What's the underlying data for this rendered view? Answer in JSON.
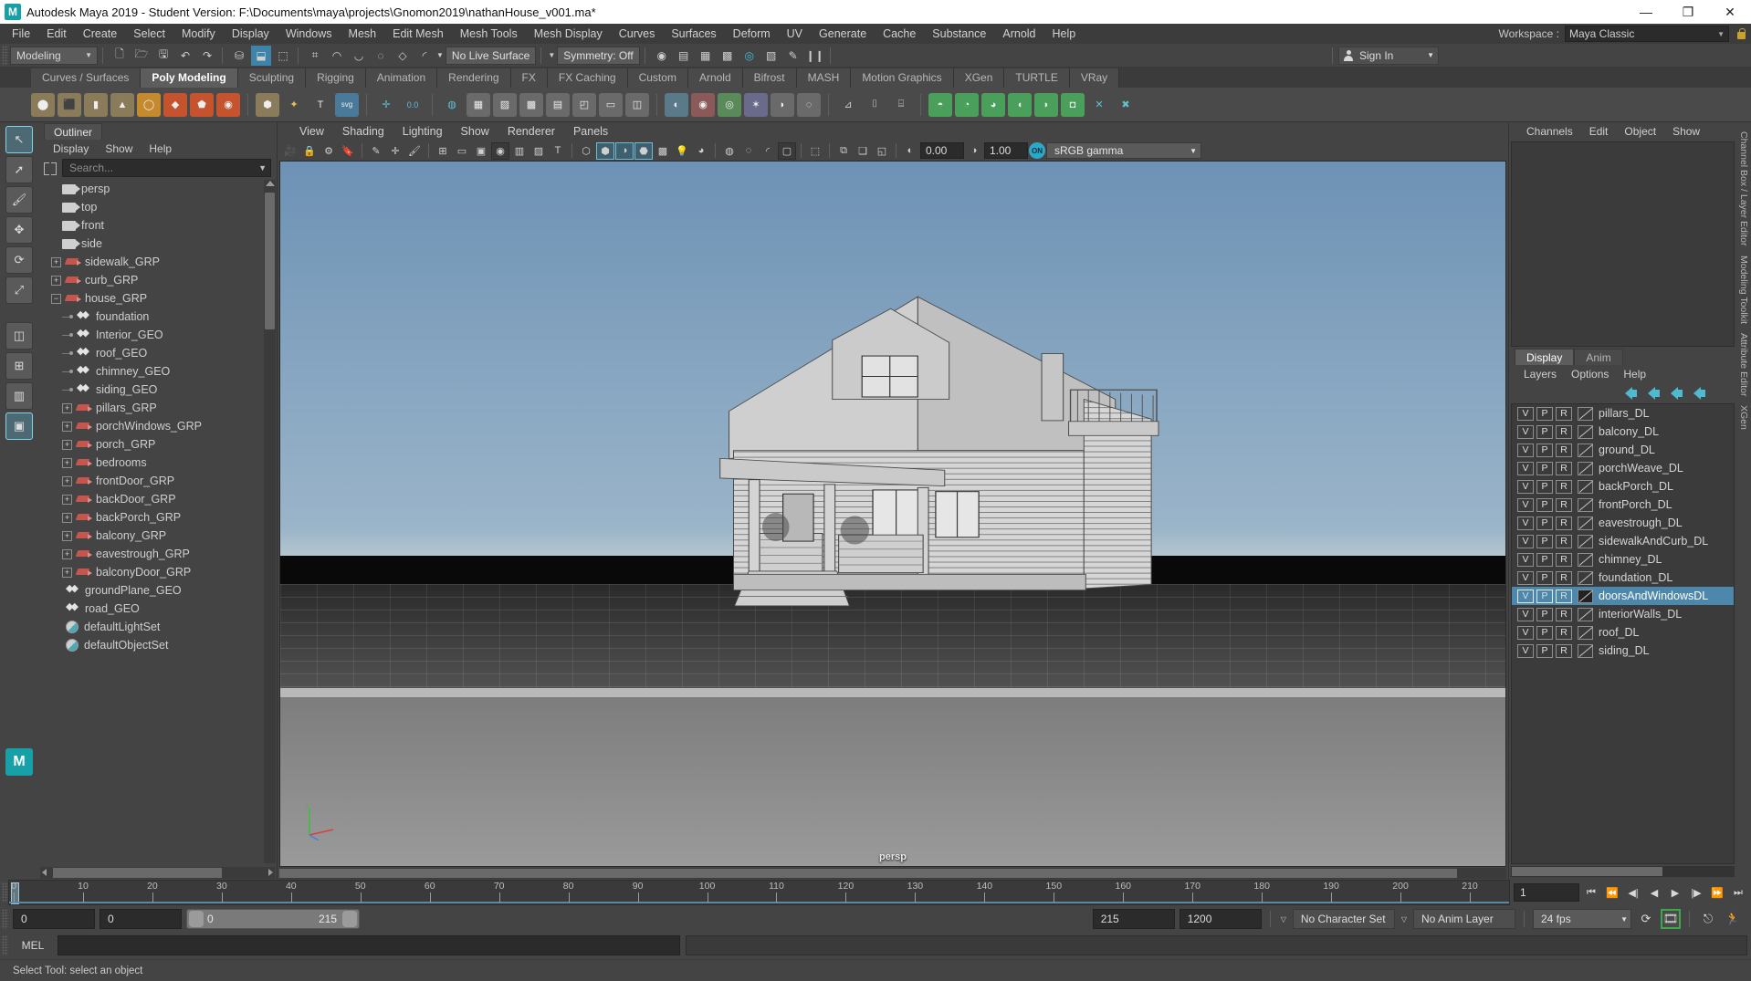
{
  "titlebar": {
    "title": "Autodesk Maya 2019 - Student Version: F:\\Documents\\maya\\projects\\Gnomon2019\\nathanHouse_v001.ma*",
    "minimize": "—",
    "maximize": "❐",
    "close": "✕",
    "logo": "M"
  },
  "menubar": {
    "items": [
      "File",
      "Edit",
      "Create",
      "Select",
      "Modify",
      "Display",
      "Windows",
      "Mesh",
      "Edit Mesh",
      "Mesh Tools",
      "Mesh Display",
      "Curves",
      "Surfaces",
      "Deform",
      "UV",
      "Generate",
      "Cache",
      "Substance",
      "Arnold",
      "Help"
    ],
    "workspace_label": "Workspace :",
    "workspace_value": "Maya Classic"
  },
  "statusline": {
    "menu_set": "Modeling",
    "live_surface": "No Live Surface",
    "symmetry": "Symmetry: Off",
    "sign_in": "Sign In",
    "icons": [
      "new-scene-icon",
      "open-scene-icon",
      "save-scene-icon",
      "undo-icon",
      "redo-icon",
      "select-by-hierarchy-icon",
      "select-by-object-icon",
      "select-by-component-icon",
      "snap-to-grid-icon",
      "snap-to-curve-icon",
      "snap-to-point-icon",
      "snap-to-projected-center-icon",
      "snap-to-view-plane-icon",
      "make-live-icon",
      "render-current-frame-icon",
      "ipr-render-icon",
      "render-settings-icon",
      "hypershade-icon",
      "render-view-icon",
      "render-setup-icon",
      "pause-render-icon"
    ]
  },
  "shelf": {
    "tabs": [
      "Curves / Surfaces",
      "Poly Modeling",
      "Sculpting",
      "Rigging",
      "Animation",
      "Rendering",
      "FX",
      "FX Caching",
      "Custom",
      "Arnold",
      "Bifrost",
      "MASH",
      "Motion Graphics",
      "XGen",
      "TURTLE",
      "VRay"
    ],
    "active_tab": "Poly Modeling",
    "buttons": [
      "poly-sphere-icon",
      "poly-cube-icon",
      "poly-cylinder-icon",
      "poly-cone-icon",
      "poly-torus-icon",
      "poly-plane-icon",
      "poly-pyramid-icon",
      "poly-helix-icon",
      "poly-soccer-ball-icon",
      "poly-platonic-icon",
      "poly-svg-icon",
      "poly-type-icon",
      "poly-svg-file-icon",
      "combine-icon",
      "booleans-icon",
      "smooth-icon",
      "extrude-icon",
      "bevel-icon",
      "bridge-icon",
      "multi-cut-icon",
      "insert-edge-loop-icon",
      "offset-edge-loop-icon",
      "target-weld-icon",
      "merge-icon",
      "poke-icon",
      "wedge-icon",
      "circularize-icon",
      "quad-draw-icon",
      "mirror-icon",
      "remesh-icon",
      "retopologize-icon",
      "crease-icon",
      "sculpt-icon",
      "append-polygon-icon",
      "slide-edge-icon",
      "paint-reduce-icon",
      "triangulate-icon",
      "quadrangulate-icon",
      "delete-edge-icon"
    ]
  },
  "toolbox": {
    "tools": [
      "select-tool",
      "lasso-select-tool",
      "paint-select-tool",
      "move-tool",
      "rotate-tool",
      "scale-tool",
      "last-tool-used",
      "show-manipulator-tool",
      "outliner-layout-icon",
      "persp-layout-icon",
      "four-view-layout-icon",
      "hypershade-layout-icon"
    ],
    "maya_badge": "M"
  },
  "outliner": {
    "tab": "Outliner",
    "menus": [
      "Display",
      "Show",
      "Help"
    ],
    "search_placeholder": "Search...",
    "items": [
      {
        "label": "persp",
        "icon": "camera-icon",
        "type": "camera",
        "depth": 1
      },
      {
        "label": "top",
        "icon": "camera-icon",
        "type": "camera",
        "depth": 1
      },
      {
        "label": "front",
        "icon": "camera-icon",
        "type": "camera",
        "depth": 1
      },
      {
        "label": "side",
        "icon": "camera-icon",
        "type": "camera",
        "depth": 1
      },
      {
        "label": "sidewalk_GRP",
        "icon": "group-icon",
        "type": "group",
        "depth": 0,
        "expander": "+"
      },
      {
        "label": "curb_GRP",
        "icon": "group-icon",
        "type": "group",
        "depth": 0,
        "expander": "+"
      },
      {
        "label": "house_GRP",
        "icon": "group-icon",
        "type": "group",
        "depth": 0,
        "expander": "−"
      },
      {
        "label": "foundation",
        "icon": "mesh-icon",
        "type": "mesh",
        "depth": 1
      },
      {
        "label": "Interior_GEO",
        "icon": "mesh-icon",
        "type": "mesh",
        "depth": 1
      },
      {
        "label": "roof_GEO",
        "icon": "mesh-icon",
        "type": "mesh",
        "depth": 1
      },
      {
        "label": "chimney_GEO",
        "icon": "mesh-icon",
        "type": "mesh",
        "depth": 1
      },
      {
        "label": "siding_GEO",
        "icon": "mesh-icon",
        "type": "mesh",
        "depth": 1
      },
      {
        "label": "pillars_GRP",
        "icon": "group-icon",
        "type": "group",
        "depth": 1,
        "expander": "+"
      },
      {
        "label": "porchWindows_GRP",
        "icon": "group-icon",
        "type": "group",
        "depth": 1,
        "expander": "+"
      },
      {
        "label": "porch_GRP",
        "icon": "group-icon",
        "type": "group",
        "depth": 1,
        "expander": "+"
      },
      {
        "label": "bedrooms",
        "icon": "group-icon",
        "type": "group",
        "depth": 1,
        "expander": "+"
      },
      {
        "label": "frontDoor_GRP",
        "icon": "group-icon",
        "type": "group",
        "depth": 1,
        "expander": "+"
      },
      {
        "label": "backDoor_GRP",
        "icon": "group-icon",
        "type": "group",
        "depth": 1,
        "expander": "+"
      },
      {
        "label": "backPorch_GRP",
        "icon": "group-icon",
        "type": "group",
        "depth": 1,
        "expander": "+"
      },
      {
        "label": "balcony_GRP",
        "icon": "group-icon",
        "type": "group",
        "depth": 1,
        "expander": "+"
      },
      {
        "label": "eavestrough_GRP",
        "icon": "group-icon",
        "type": "group",
        "depth": 1,
        "expander": "+"
      },
      {
        "label": "balconyDoor_GRP",
        "icon": "group-icon",
        "type": "group",
        "depth": 1,
        "expander": "+"
      },
      {
        "label": "groundPlane_GEO",
        "icon": "mesh-icon",
        "type": "mesh",
        "depth": 0
      },
      {
        "label": "road_GEO",
        "icon": "mesh-icon",
        "type": "mesh",
        "depth": 0
      },
      {
        "label": "defaultLightSet",
        "icon": "set-icon",
        "type": "set",
        "depth": 0
      },
      {
        "label": "defaultObjectSet",
        "icon": "set-icon",
        "type": "set",
        "depth": 0
      }
    ]
  },
  "viewport": {
    "menus": [
      "View",
      "Shading",
      "Lighting",
      "Show",
      "Renderer",
      "Panels"
    ],
    "exposure": "0.00",
    "gamma": "1.00",
    "color_space": "sRGB gamma",
    "on_badge": "ON",
    "camera_label": "persp",
    "toolbar_icons": [
      "camera-icon",
      "camera-lock-icon",
      "camera-attributes-icon",
      "bookmark-icon",
      "grease-pencil-icon",
      "image-plane-icon",
      "paint-effects-icon",
      "grid-icon",
      "film-gate-icon",
      "resolution-gate-icon",
      "gate-mask-icon",
      "field-chart-icon",
      "safe-action-icon",
      "safe-title-icon",
      "wireframe-icon",
      "smooth-shade-icon",
      "shaded-wireframe-icon",
      "textured-icon",
      "lighting-icon",
      "shadows-icon",
      "ao-icon",
      "motion-blur-icon",
      "aa-icon",
      "xray-icon",
      "isolate-select-icon",
      "panel-zoom-icon",
      "exposure-icon",
      "gamma-icon"
    ]
  },
  "channelbox": {
    "menus": [
      "Channels",
      "Edit",
      "Object",
      "Show"
    ]
  },
  "layer_editor": {
    "tabs": [
      "Display",
      "Anim"
    ],
    "active_tab": "Display",
    "menus": [
      "Layers",
      "Options",
      "Help"
    ],
    "toolbar_buttons": [
      "move-layer-up-icon",
      "move-layer-down-icon",
      "create-new-layer-icon",
      "create-layer-from-selected-icon"
    ],
    "column_headers": [
      "V",
      "P",
      "R"
    ],
    "layers": [
      {
        "name": "pillars_DL",
        "v": "V",
        "p": "P",
        "r": "R",
        "selected": false
      },
      {
        "name": "balcony_DL",
        "v": "V",
        "p": "P",
        "r": "R",
        "selected": false
      },
      {
        "name": "ground_DL",
        "v": "V",
        "p": "P",
        "r": "R",
        "selected": false
      },
      {
        "name": "porchWeave_DL",
        "v": "V",
        "p": "P",
        "r": "R",
        "selected": false
      },
      {
        "name": "backPorch_DL",
        "v": "V",
        "p": "P",
        "r": "R",
        "selected": false
      },
      {
        "name": "frontPorch_DL",
        "v": "V",
        "p": "P",
        "r": "R",
        "selected": false
      },
      {
        "name": "eavestrough_DL",
        "v": "V",
        "p": "P",
        "r": "R",
        "selected": false
      },
      {
        "name": "sidewalkAndCurb_DL",
        "v": "V",
        "p": "P",
        "r": "R",
        "selected": false
      },
      {
        "name": "chimney_DL",
        "v": "V",
        "p": "P",
        "r": "R",
        "selected": false
      },
      {
        "name": "foundation_DL",
        "v": "V",
        "p": "P",
        "r": "R",
        "selected": false
      },
      {
        "name": "doorsAndWindowsDL",
        "v": "V",
        "p": "P",
        "r": "R",
        "selected": true
      },
      {
        "name": "interiorWalls_DL",
        "v": "V",
        "p": "P",
        "r": "R",
        "selected": false
      },
      {
        "name": "roof_DL",
        "v": "V",
        "p": "P",
        "r": "R",
        "selected": false
      },
      {
        "name": "siding_DL",
        "v": "V",
        "p": "P",
        "r": "R",
        "selected": false
      }
    ]
  },
  "side_tabs": [
    "Channel Box / Layer Editor",
    "Modeling Toolkit",
    "Attribute Editor",
    "XGen"
  ],
  "timeline": {
    "ticks": [
      0,
      10,
      20,
      30,
      40,
      50,
      60,
      70,
      80,
      90,
      100,
      110,
      120,
      130,
      140,
      150,
      160,
      170,
      180,
      190,
      200,
      210
    ],
    "current_frame": "1",
    "playback_buttons": [
      "go-to-start-icon",
      "step-back-key-icon",
      "step-back-frame-icon",
      "play-backwards-icon",
      "play-forwards-icon",
      "step-forward-frame-icon",
      "step-forward-key-icon",
      "go-to-end-icon"
    ]
  },
  "range_slider": {
    "anim_start": "0",
    "playback_start": "0",
    "range_bar_left": "0",
    "range_bar_right": "215",
    "playback_end": "215",
    "anim_end": "1200",
    "character_set": "No Character Set",
    "anim_layer": "No Anim Layer",
    "fps": "24 fps",
    "buttons": [
      "auto-key-icon",
      "animation-preferences-icon",
      "playback-loop-icon"
    ]
  },
  "command_line": {
    "language": "MEL",
    "input_value": "",
    "output_value": ""
  },
  "status_bar": {
    "message": "Select Tool: select an object"
  },
  "colors": {
    "accent": "#4d87ab",
    "teal": "#17a0a8",
    "panel_bg": "#444444",
    "dark_field": "#2b2b2b",
    "group_icon": "#c4564e"
  }
}
